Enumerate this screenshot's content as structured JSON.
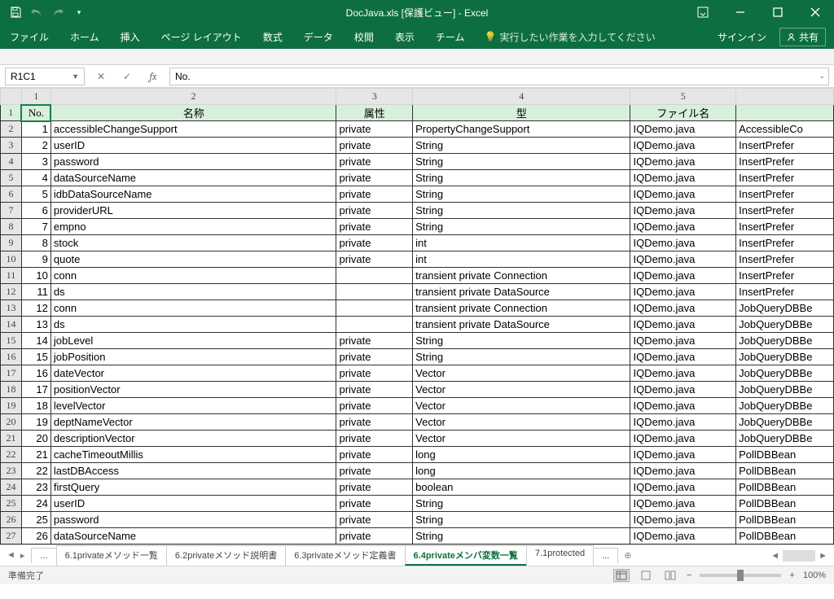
{
  "title": "DocJava.xls  [保護ビュー] - Excel",
  "ribbon": {
    "tabs": [
      "ファイル",
      "ホーム",
      "挿入",
      "ページ レイアウト",
      "数式",
      "データ",
      "校閲",
      "表示",
      "チーム"
    ],
    "tellme": "実行したい作業を入力してください",
    "signin": "サインイン",
    "share": "共有"
  },
  "namebox": "R1C1",
  "formula": "No.",
  "columns": {
    "widths": [
      26,
      36,
      352,
      94,
      268,
      130,
      120
    ],
    "labels": [
      "",
      "1",
      "2",
      "3",
      "4",
      "5",
      ""
    ]
  },
  "headers": [
    "No.",
    "名称",
    "属性",
    "型",
    "ファイル名",
    ""
  ],
  "rows": [
    {
      "n": 1,
      "name": "accessibleChangeSupport",
      "attr": "private",
      "type": "PropertyChangeSupport",
      "file": "IQDemo.java",
      "f2": "AccessibleCo"
    },
    {
      "n": 2,
      "name": "userID",
      "attr": "private",
      "type": "String",
      "file": "IQDemo.java",
      "f2": "InsertPrefer"
    },
    {
      "n": 3,
      "name": "password",
      "attr": "private",
      "type": "String",
      "file": "IQDemo.java",
      "f2": "InsertPrefer"
    },
    {
      "n": 4,
      "name": "dataSourceName",
      "attr": "private",
      "type": "String",
      "file": "IQDemo.java",
      "f2": "InsertPrefer"
    },
    {
      "n": 5,
      "name": "idbDataSourceName",
      "attr": "private",
      "type": "String",
      "file": "IQDemo.java",
      "f2": "InsertPrefer"
    },
    {
      "n": 6,
      "name": "providerURL",
      "attr": "private",
      "type": "String",
      "file": "IQDemo.java",
      "f2": "InsertPrefer"
    },
    {
      "n": 7,
      "name": "empno",
      "attr": "private",
      "type": "String",
      "file": "IQDemo.java",
      "f2": "InsertPrefer"
    },
    {
      "n": 8,
      "name": "stock",
      "attr": "private",
      "type": "int",
      "file": "IQDemo.java",
      "f2": "InsertPrefer"
    },
    {
      "n": 9,
      "name": "quote",
      "attr": "private",
      "type": "int",
      "file": "IQDemo.java",
      "f2": "InsertPrefer"
    },
    {
      "n": 10,
      "name": "conn",
      "attr": "",
      "type": "transient private Connection",
      "file": "IQDemo.java",
      "f2": "InsertPrefer"
    },
    {
      "n": 11,
      "name": "ds",
      "attr": "",
      "type": "transient private DataSource",
      "file": "IQDemo.java",
      "f2": "InsertPrefer"
    },
    {
      "n": 12,
      "name": "conn",
      "attr": "",
      "type": "transient private Connection",
      "file": "IQDemo.java",
      "f2": "JobQueryDBBe"
    },
    {
      "n": 13,
      "name": "ds",
      "attr": "",
      "type": "transient private DataSource",
      "file": "IQDemo.java",
      "f2": "JobQueryDBBe"
    },
    {
      "n": 14,
      "name": "jobLevel",
      "attr": "private",
      "type": "String",
      "file": "IQDemo.java",
      "f2": "JobQueryDBBe"
    },
    {
      "n": 15,
      "name": "jobPosition",
      "attr": "private",
      "type": "String",
      "file": "IQDemo.java",
      "f2": "JobQueryDBBe"
    },
    {
      "n": 16,
      "name": "dateVector",
      "attr": "private",
      "type": "Vector",
      "file": "IQDemo.java",
      "f2": "JobQueryDBBe"
    },
    {
      "n": 17,
      "name": "positionVector",
      "attr": "private",
      "type": "Vector",
      "file": "IQDemo.java",
      "f2": "JobQueryDBBe"
    },
    {
      "n": 18,
      "name": "levelVector",
      "attr": "private",
      "type": "Vector",
      "file": "IQDemo.java",
      "f2": "JobQueryDBBe"
    },
    {
      "n": 19,
      "name": "deptNameVector",
      "attr": "private",
      "type": "Vector",
      "file": "IQDemo.java",
      "f2": "JobQueryDBBe"
    },
    {
      "n": 20,
      "name": "descriptionVector",
      "attr": "private",
      "type": "Vector",
      "file": "IQDemo.java",
      "f2": "JobQueryDBBe"
    },
    {
      "n": 21,
      "name": "cacheTimeoutMillis",
      "attr": "private",
      "type": "long",
      "file": "IQDemo.java",
      "f2": "PollDBBean"
    },
    {
      "n": 22,
      "name": "lastDBAccess",
      "attr": "private",
      "type": "long",
      "file": "IQDemo.java",
      "f2": "PollDBBean"
    },
    {
      "n": 23,
      "name": "firstQuery",
      "attr": "private",
      "type": "boolean",
      "file": "IQDemo.java",
      "f2": "PollDBBean"
    },
    {
      "n": 24,
      "name": "userID",
      "attr": "private",
      "type": "String",
      "file": "IQDemo.java",
      "f2": "PollDBBean"
    },
    {
      "n": 25,
      "name": "password",
      "attr": "private",
      "type": "String",
      "file": "IQDemo.java",
      "f2": "PollDBBean"
    },
    {
      "n": 26,
      "name": "dataSourceName",
      "attr": "private",
      "type": "String",
      "file": "IQDemo.java",
      "f2": "PollDBBean"
    }
  ],
  "sheets": {
    "more": "...",
    "tabs": [
      {
        "label": "6.1privateメソッド一覧",
        "active": false
      },
      {
        "label": "6.2privateメソッド説明書",
        "active": false
      },
      {
        "label": "6.3privateメソッド定義書",
        "active": false
      },
      {
        "label": "6.4privateメンバ変数一覧",
        "active": true
      },
      {
        "label": "7.1protected",
        "active": false
      }
    ],
    "moreR": "..."
  },
  "status": {
    "ready": "準備完了",
    "zoom": "100%"
  }
}
